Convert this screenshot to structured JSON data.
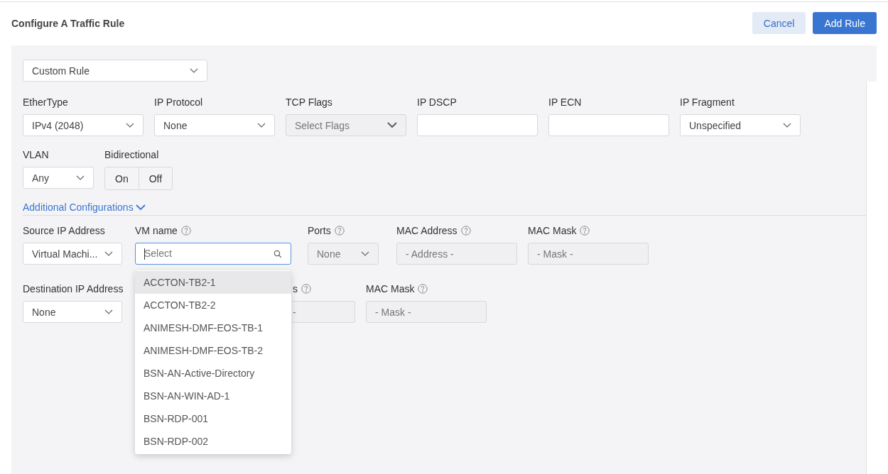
{
  "header": {
    "title": "Configure A Traffic Rule",
    "buttons": [
      {
        "label": "Cancel",
        "kind": "secondary"
      },
      {
        "label": "Add Rule",
        "kind": "primary"
      }
    ]
  },
  "rule_type": {
    "value": "Custom Rule"
  },
  "match_rows": [
    {
      "fields": [
        {
          "label": "EtherType",
          "kind": "select",
          "value": "IPv4 (2048)",
          "disabled": false
        },
        {
          "label": "IP Protocol",
          "kind": "select",
          "value": "None",
          "disabled": false
        },
        {
          "label": "TCP Flags",
          "kind": "multiselect",
          "placeholder": "Select Flags",
          "disabled": true
        },
        {
          "label": "IP DSCP",
          "kind": "input",
          "disabled": false
        },
        {
          "label": "IP ECN",
          "kind": "input",
          "disabled": false
        },
        {
          "label": "IP Fragment",
          "kind": "select",
          "value": "Unspecified",
          "disabled": false
        }
      ]
    },
    {
      "fields": [
        {
          "label": "VLAN",
          "kind": "select",
          "value": "Any",
          "disabled": false
        },
        {
          "label": "Bidirectional",
          "kind": "toggle",
          "options": [
            {
              "label": "On",
              "selected": false
            },
            {
              "label": "Off",
              "selected": false
            }
          ]
        }
      ]
    }
  ],
  "additional": {
    "label": "Additional Configurations",
    "expanded": true
  },
  "address_rows": [
    {
      "fields": [
        {
          "label": "Source IP Address",
          "kind": "select",
          "value": "Virtual Machi...",
          "disabled": false,
          "help": false
        },
        {
          "label": "VM name",
          "kind": "search",
          "placeholder": "Select",
          "focused": true,
          "disabled": false,
          "help": true
        },
        {
          "label": "Ports",
          "kind": "select",
          "value": "None",
          "disabled": true,
          "help": true
        },
        {
          "label": "MAC Address",
          "kind": "input",
          "placeholder": "- Address -",
          "disabled": true,
          "help": true
        },
        {
          "label": "MAC Mask",
          "kind": "input",
          "placeholder": "- Mask -",
          "disabled": true,
          "help": true
        }
      ]
    },
    {
      "fields": [
        {
          "label": "Destination IP Address",
          "kind": "select",
          "value": "None",
          "disabled": false,
          "help": false
        },
        {
          "label": "s",
          "kind": "partial-input",
          "placeholder": "-",
          "disabled": true,
          "help": true
        },
        {
          "label": "MAC Mask",
          "kind": "input",
          "placeholder": "- Mask -",
          "disabled": true,
          "help": true
        }
      ]
    }
  ],
  "vm_dropdown": {
    "options": [
      {
        "label": "ACCTON-TB2-1",
        "selected": true
      },
      {
        "label": "ACCTON-TB2-2",
        "selected": false
      },
      {
        "label": "ANIMESH-DMF-EOS-TB-1",
        "selected": false
      },
      {
        "label": "ANIMESH-DMF-EOS-TB-2",
        "selected": false
      },
      {
        "label": "BSN-AN-Active-Directory",
        "selected": false
      },
      {
        "label": "BSN-AN-WIN-AD-1",
        "selected": false
      },
      {
        "label": "BSN-RDP-001",
        "selected": false
      },
      {
        "label": "BSN-RDP-002",
        "selected": false
      }
    ]
  }
}
